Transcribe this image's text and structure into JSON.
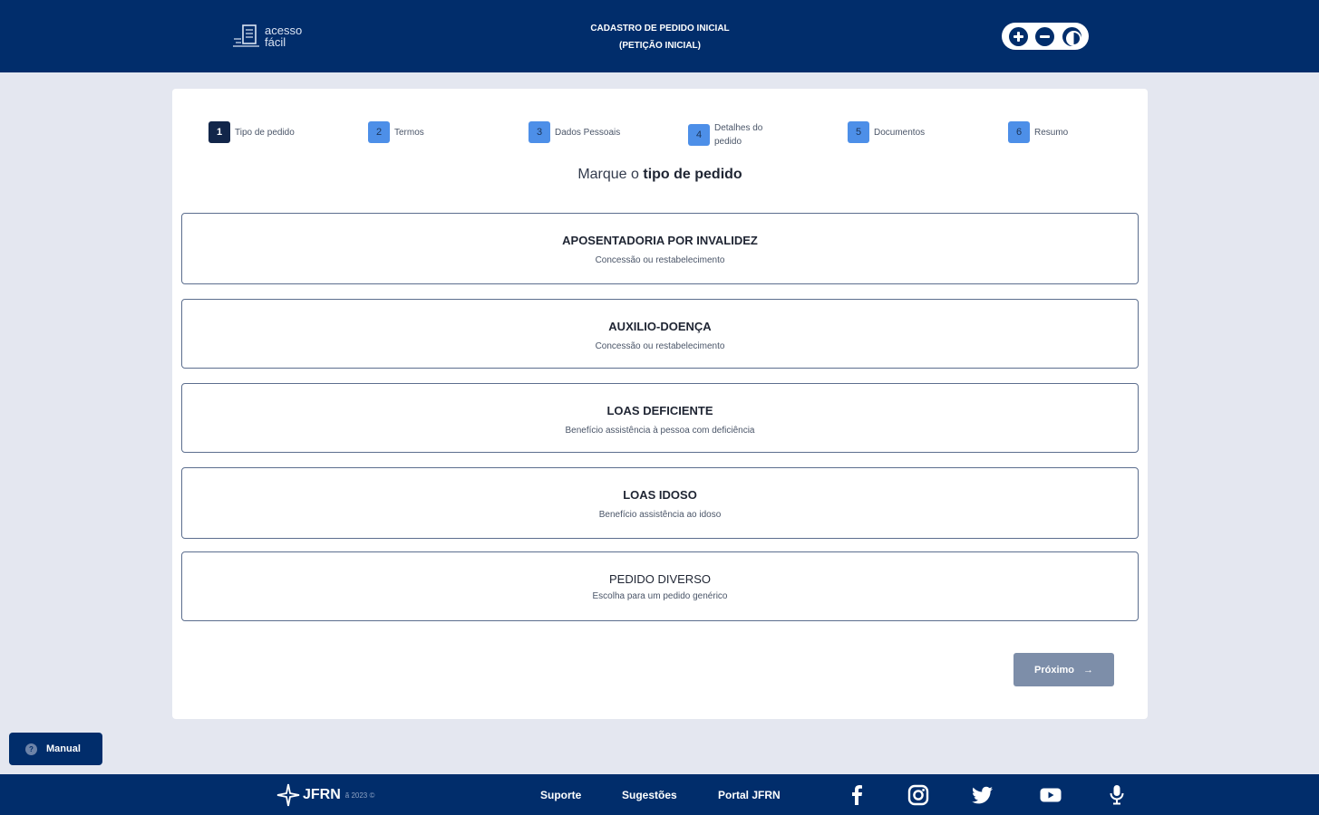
{
  "header": {
    "logo_line1": "acesso",
    "logo_line2": "fácil",
    "title_line1": "CADASTRO DE PEDIDO INICIAL",
    "title_line2": "(PETIÇÃO INICIAL)"
  },
  "steps": [
    {
      "num": "1",
      "label": "Tipo de pedido"
    },
    {
      "num": "2",
      "label": "Termos"
    },
    {
      "num": "3",
      "label": "Dados Pessoais"
    },
    {
      "num": "4",
      "label": "Detalhes do pedido"
    },
    {
      "num": "5",
      "label": "Documentos"
    },
    {
      "num": "6",
      "label": "Resumo"
    }
  ],
  "prompt": {
    "prefix": "Marque o ",
    "bold": "tipo de pedido"
  },
  "options": [
    {
      "title": "APOSENTADORIA POR INVALIDEZ",
      "subtitle": "Concessão ou restabelecimento"
    },
    {
      "title": "AUXILIO-DOENÇA",
      "subtitle": "Concessão ou restabelecimento"
    },
    {
      "title": "LOAS DEFICIENTE",
      "subtitle": "Benefício assistência à pessoa com deficiência"
    },
    {
      "title": "LOAS IDOSO",
      "subtitle": "Benefício assistência ao idoso"
    },
    {
      "title": "PEDIDO DIVERSO",
      "subtitle": "Escolha para um pedido genérico"
    }
  ],
  "next_button": {
    "label": "Próximo",
    "arrow": "→"
  },
  "manual_button": {
    "label": "Manual",
    "icon": "?"
  },
  "footer": {
    "brand": "JFRN",
    "year": "ã 2023 ©",
    "links": [
      "Suporte",
      "Sugestões",
      "Portal JFRN"
    ]
  },
  "colors": {
    "primary": "#012d6b",
    "background": "#e4e7f0",
    "step_active": "#12264a",
    "step_inactive": "#4d8fe8",
    "next_button": "#7d8ea9"
  }
}
